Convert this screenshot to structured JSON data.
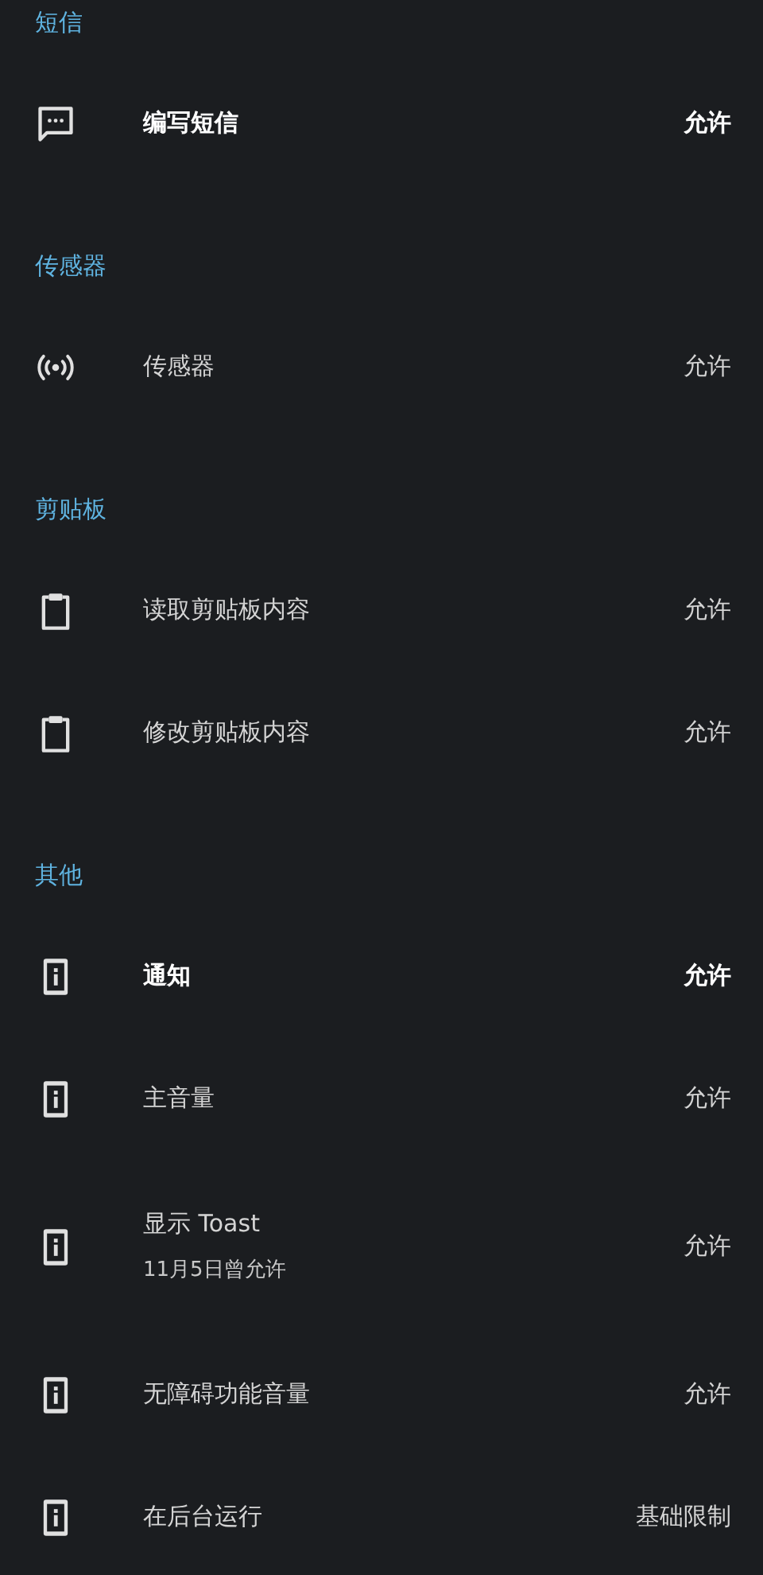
{
  "sections": [
    {
      "title": "短信",
      "items": [
        {
          "kind": "message",
          "label": "编写短信",
          "emphasized": true,
          "value": "允许"
        }
      ]
    },
    {
      "title": "传感器",
      "items": [
        {
          "kind": "sensor",
          "label": "传感器",
          "emphasized": false,
          "value": "允许"
        }
      ]
    },
    {
      "title": "剪贴板",
      "items": [
        {
          "kind": "clipboard",
          "label": "读取剪贴板内容",
          "emphasized": false,
          "value": "允许"
        },
        {
          "kind": "clipboard",
          "label": "修改剪贴板内容",
          "emphasized": false,
          "value": "允许"
        }
      ]
    },
    {
      "title": "其他",
      "items": [
        {
          "kind": "device",
          "label": "通知",
          "emphasized": true,
          "value": "允许"
        },
        {
          "kind": "device",
          "label": "主音量",
          "emphasized": false,
          "value": "允许"
        },
        {
          "kind": "device",
          "label": "显示 Toast",
          "subtitle": "11月5日曾允许",
          "emphasized": false,
          "value": "允许"
        },
        {
          "kind": "device",
          "label": "无障碍功能音量",
          "emphasized": false,
          "value": "允许"
        },
        {
          "kind": "device",
          "label": "在后台运行",
          "emphasized": false,
          "value": "基础限制"
        }
      ]
    }
  ]
}
